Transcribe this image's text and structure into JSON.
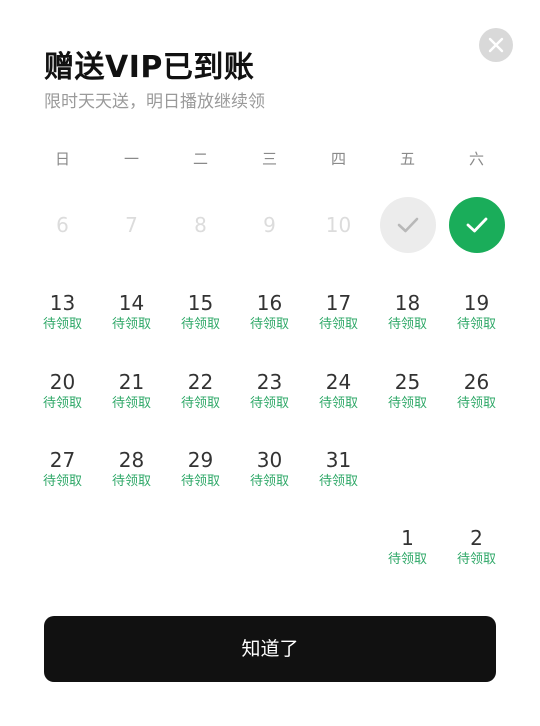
{
  "dialog": {
    "title": "赠送VIP已到账",
    "subtitle": "限时天天送，明日播放继续领",
    "close_icon": "close-icon",
    "confirm_label": "知道了"
  },
  "calendar": {
    "weekdays": [
      "日",
      "一",
      "二",
      "三",
      "四",
      "五",
      "六"
    ],
    "past_days": [
      "6",
      "7",
      "8",
      "9",
      "10"
    ],
    "claimed_icon": "check-icon",
    "claimed_today_icon": "check-icon",
    "pending_label": "待领取",
    "pending_days": [
      "13",
      "14",
      "15",
      "16",
      "17",
      "18",
      "19",
      "20",
      "21",
      "22",
      "23",
      "24",
      "25",
      "26",
      "27",
      "28",
      "29",
      "30",
      "31",
      "1",
      "2"
    ]
  },
  "colors": {
    "accent_green": "#1aad5a",
    "pending_text_green": "#2fa868",
    "button_black": "#111111"
  }
}
